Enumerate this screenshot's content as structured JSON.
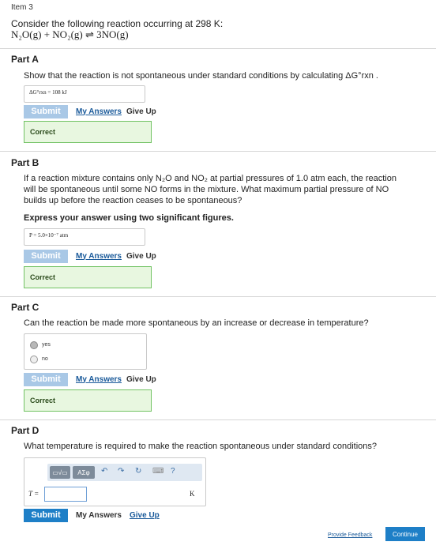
{
  "item_title": "Item 3",
  "intro": "Consider the following reaction occurring at 298 K:",
  "equation": "N₂O(g) + NO₂(g) ⇌ 3NO(g)",
  "part_a": {
    "heading": "Part A",
    "prompt": "Show that the reaction is not spontaneous under standard conditions by calculating ΔG°rxn .",
    "answer": "ΔG°rxn = 108  kJ",
    "submit": "Submit",
    "my_answers": "My Answers",
    "give_up": "Give Up",
    "feedback": "Correct"
  },
  "part_b": {
    "heading": "Part B",
    "prompt": "If a reaction mixture contains only N₂O and NO₂ at partial pressures of 1.0 atm each, the reaction will be spontaneous until some NO forms in the mixture. What maximum partial pressure of NO builds up before the reaction ceases to be spontaneous?",
    "instruction": "Express your answer using two significant figures.",
    "answer": "P = 5.0×10⁻⁷  atm",
    "submit": "Submit",
    "my_answers": "My Answers",
    "give_up": "Give Up",
    "feedback": "Correct"
  },
  "part_c": {
    "heading": "Part C",
    "prompt": "Can the reaction be made more spontaneous by an increase or decrease in temperature?",
    "options": [
      "yes",
      "no"
    ],
    "selected": "yes",
    "submit": "Submit",
    "my_answers": "My Answers",
    "give_up": "Give Up",
    "feedback": "Correct"
  },
  "part_d": {
    "heading": "Part D",
    "prompt": "What temperature is required to make the reaction spontaneous under standard conditions?",
    "toolbar": {
      "templates": "▭√▭",
      "symbols": "ΑΣφ",
      "undo": "↶",
      "redo": "↷",
      "reset": "↻",
      "keyboard": "⌨",
      "help": "?"
    },
    "var_label": "T =",
    "input_value": "",
    "unit": "K",
    "submit": "Submit",
    "my_answers": "My Answers",
    "give_up": "Give Up"
  },
  "footer": {
    "provide_feedback": "Provide Feedback",
    "continue": "Continue"
  }
}
